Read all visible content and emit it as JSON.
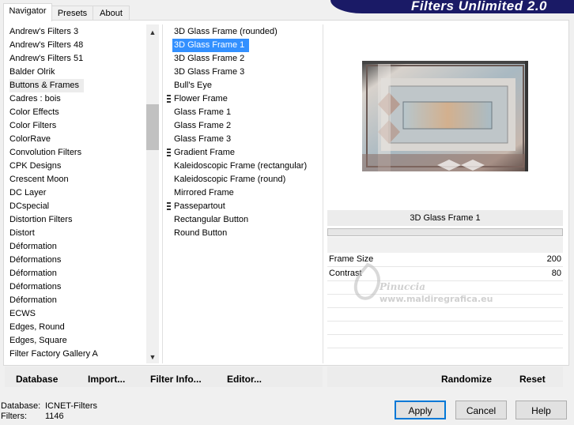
{
  "tabs": [
    {
      "label": "Navigator",
      "active": true
    },
    {
      "label": "Presets",
      "active": false
    },
    {
      "label": "About",
      "active": false
    }
  ],
  "banner": {
    "title": "Filters Unlimited 2.0"
  },
  "categories": {
    "items": [
      "Andrew's Filters 3",
      "Andrew's Filters 48",
      "Andrew's Filters 51",
      "Balder Olrik",
      "Buttons & Frames",
      "Cadres : bois",
      "Color Effects",
      "Color Filters",
      "ColorRave",
      "Convolution Filters",
      "CPK Designs",
      "Crescent Moon",
      "DC Layer",
      "DCspecial",
      "Distortion Filters",
      "Distort",
      "Déformation",
      "Déformations",
      "Déformation",
      "Déformations",
      "Déformation",
      "ECWS",
      "Edges, Round",
      "Edges, Square",
      "Filter Factory Gallery A"
    ],
    "selected_index": 4
  },
  "filters": {
    "items": [
      {
        "label": "3D Glass Frame (rounded)",
        "marker": false
      },
      {
        "label": "3D Glass Frame 1",
        "marker": false
      },
      {
        "label": "3D Glass Frame 2",
        "marker": false
      },
      {
        "label": "3D Glass Frame 3",
        "marker": false
      },
      {
        "label": "Bull's Eye",
        "marker": false
      },
      {
        "label": "Flower Frame",
        "marker": true
      },
      {
        "label": "Glass Frame 1",
        "marker": false
      },
      {
        "label": "Glass Frame 2",
        "marker": false
      },
      {
        "label": "Glass Frame 3",
        "marker": false
      },
      {
        "label": "Gradient Frame",
        "marker": true
      },
      {
        "label": "Kaleidoscopic Frame (rectangular)",
        "marker": false
      },
      {
        "label": "Kaleidoscopic Frame (round)",
        "marker": false
      },
      {
        "label": "Mirrored Frame",
        "marker": false
      },
      {
        "label": "Passepartout",
        "marker": true
      },
      {
        "label": "Rectangular Button",
        "marker": false
      },
      {
        "label": "Round Button",
        "marker": false
      }
    ],
    "selected_index": 1
  },
  "preview": {
    "filter_name": "3D Glass Frame 1"
  },
  "params": [
    {
      "name": "Frame Size",
      "value": "200",
      "level": 0.78
    },
    {
      "name": "Contrast",
      "value": "80",
      "level": 0.31
    }
  ],
  "watermark": {
    "line1": "Pinuccia",
    "line2": "www.maldiregrafica.eu"
  },
  "toolbar_left": {
    "database": "Database",
    "import": "Import...",
    "filter_info": "Filter Info...",
    "editor": "Editor..."
  },
  "toolbar_right": {
    "randomize": "Randomize",
    "reset": "Reset"
  },
  "status": {
    "database_label": "Database:",
    "database_value": "ICNET-Filters",
    "filters_label": "Filters:",
    "filters_value": "1146"
  },
  "buttons": {
    "apply": "Apply",
    "cancel": "Cancel",
    "help": "Help"
  },
  "colors": {
    "accent": "#3390ff",
    "banner": "#1a1a66",
    "default_button_border": "#0078d7"
  }
}
